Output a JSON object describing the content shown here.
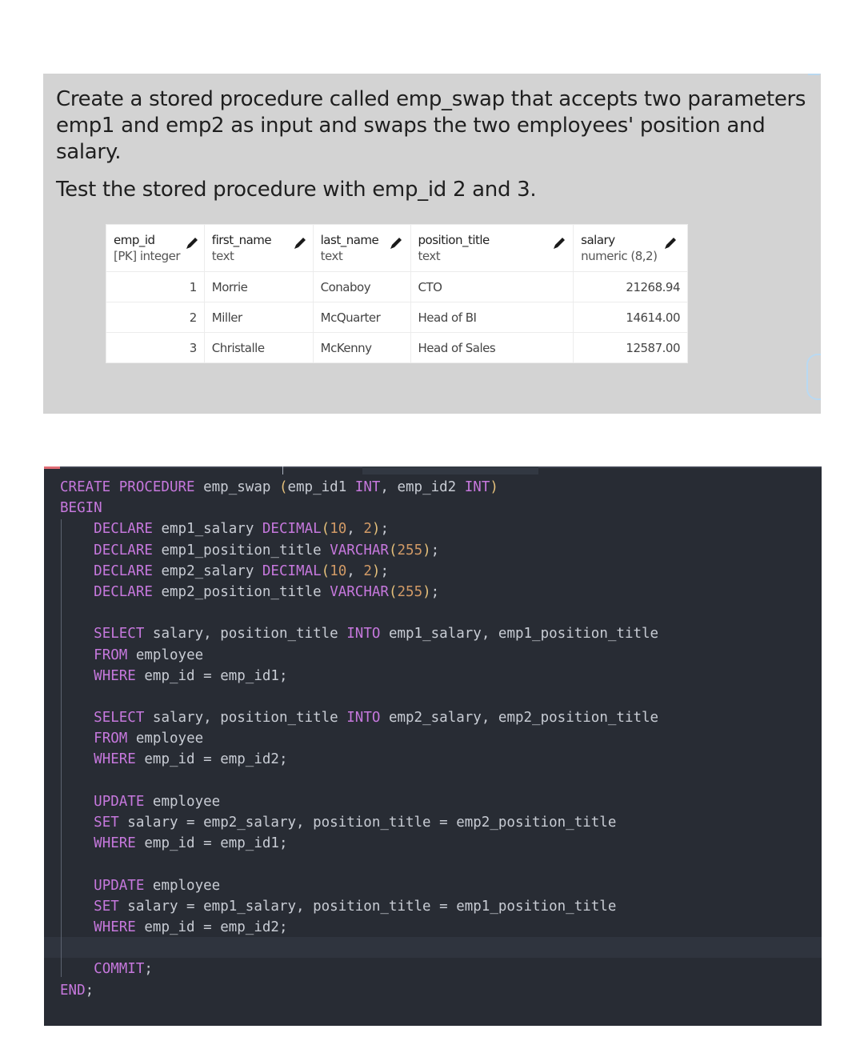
{
  "task": {
    "paragraph1": "Create a stored procedure called emp_swap that accepts two parameters emp1 and emp2 as input and swaps the two employees' position and salary.",
    "paragraph2": "Test the stored procedure with emp_id 2 and 3."
  },
  "table": {
    "columns": [
      {
        "name": "emp_id",
        "type": "[PK] integer"
      },
      {
        "name": "first_name",
        "type": "text"
      },
      {
        "name": "last_name",
        "type": "text"
      },
      {
        "name": "position_title",
        "type": "text"
      },
      {
        "name": "salary",
        "type": "numeric (8,2)"
      }
    ],
    "rows": [
      [
        "1",
        "Morrie",
        "Conaboy",
        "CTO",
        "21268.94"
      ],
      [
        "2",
        "Miller",
        "McQuarter",
        "Head of BI",
        "14614.00"
      ],
      [
        "3",
        "Christalle",
        "McKenny",
        "Head of Sales",
        "12587.00"
      ]
    ]
  },
  "editor": {
    "colors": {
      "background": "#282c34",
      "keyword": "#c678dd",
      "number": "#d19a66",
      "paren": "#e5c07b",
      "text": "#c8ccd4"
    },
    "lines": [
      [
        [
          "k",
          "CREATE PROCEDURE"
        ],
        [
          "t",
          " emp_swap "
        ],
        [
          "p",
          "("
        ],
        [
          "t",
          "emp_id1 "
        ],
        [
          "k",
          "INT"
        ],
        [
          "t",
          ", emp_id2 "
        ],
        [
          "k",
          "INT"
        ],
        [
          "p",
          ")"
        ]
      ],
      [
        [
          "k",
          "BEGIN"
        ]
      ],
      [
        [
          "t",
          "    "
        ],
        [
          "k",
          "DECLARE"
        ],
        [
          "t",
          " emp1_salary "
        ],
        [
          "k",
          "DECIMAL"
        ],
        [
          "p",
          "("
        ],
        [
          "n",
          "10"
        ],
        [
          "t",
          ", "
        ],
        [
          "n",
          "2"
        ],
        [
          "p",
          ")"
        ],
        [
          "t",
          ";"
        ]
      ],
      [
        [
          "t",
          "    "
        ],
        [
          "k",
          "DECLARE"
        ],
        [
          "t",
          " emp1_position_title "
        ],
        [
          "k",
          "VARCHAR"
        ],
        [
          "p",
          "("
        ],
        [
          "n",
          "255"
        ],
        [
          "p",
          ")"
        ],
        [
          "t",
          ";"
        ]
      ],
      [
        [
          "t",
          "    "
        ],
        [
          "k",
          "DECLARE"
        ],
        [
          "t",
          " emp2_salary "
        ],
        [
          "k",
          "DECIMAL"
        ],
        [
          "p",
          "("
        ],
        [
          "n",
          "10"
        ],
        [
          "t",
          ", "
        ],
        [
          "n",
          "2"
        ],
        [
          "p",
          ")"
        ],
        [
          "t",
          ";"
        ]
      ],
      [
        [
          "t",
          "    "
        ],
        [
          "k",
          "DECLARE"
        ],
        [
          "t",
          " emp2_position_title "
        ],
        [
          "k",
          "VARCHAR"
        ],
        [
          "p",
          "("
        ],
        [
          "n",
          "255"
        ],
        [
          "p",
          ")"
        ],
        [
          "t",
          ";"
        ]
      ],
      [],
      [
        [
          "t",
          "    "
        ],
        [
          "k",
          "SELECT"
        ],
        [
          "t",
          " salary, position_title "
        ],
        [
          "k",
          "INTO"
        ],
        [
          "t",
          " emp1_salary, emp1_position_title"
        ]
      ],
      [
        [
          "t",
          "    "
        ],
        [
          "k",
          "FROM"
        ],
        [
          "t",
          " employee"
        ]
      ],
      [
        [
          "t",
          "    "
        ],
        [
          "k",
          "WHERE"
        ],
        [
          "t",
          " emp_id = emp_id1;"
        ]
      ],
      [],
      [
        [
          "t",
          "    "
        ],
        [
          "k",
          "SELECT"
        ],
        [
          "t",
          " salary, position_title "
        ],
        [
          "k",
          "INTO"
        ],
        [
          "t",
          " emp2_salary, emp2_position_title"
        ]
      ],
      [
        [
          "t",
          "    "
        ],
        [
          "k",
          "FROM"
        ],
        [
          "t",
          " employee"
        ]
      ],
      [
        [
          "t",
          "    "
        ],
        [
          "k",
          "WHERE"
        ],
        [
          "t",
          " emp_id = emp_id2;"
        ]
      ],
      [],
      [
        [
          "t",
          "    "
        ],
        [
          "k",
          "UPDATE"
        ],
        [
          "t",
          " employee"
        ]
      ],
      [
        [
          "t",
          "    "
        ],
        [
          "k",
          "SET"
        ],
        [
          "t",
          " salary = emp2_salary, position_title = emp2_position_title"
        ]
      ],
      [
        [
          "t",
          "    "
        ],
        [
          "k",
          "WHERE"
        ],
        [
          "t",
          " emp_id = emp_id1;"
        ]
      ],
      [],
      [
        [
          "t",
          "    "
        ],
        [
          "k",
          "UPDATE"
        ],
        [
          "t",
          " employee"
        ]
      ],
      [
        [
          "t",
          "    "
        ],
        [
          "k",
          "SET"
        ],
        [
          "t",
          " salary = emp1_salary, position_title = emp1_position_title"
        ]
      ],
      [
        [
          "t",
          "    "
        ],
        [
          "k",
          "WHERE"
        ],
        [
          "t",
          " emp_id = emp_id2;"
        ]
      ],
      [],
      [
        [
          "t",
          "    "
        ],
        [
          "k",
          "COMMIT"
        ],
        [
          "t",
          ";"
        ]
      ],
      [
        [
          "k",
          "END"
        ],
        [
          "t",
          ";"
        ]
      ]
    ]
  }
}
